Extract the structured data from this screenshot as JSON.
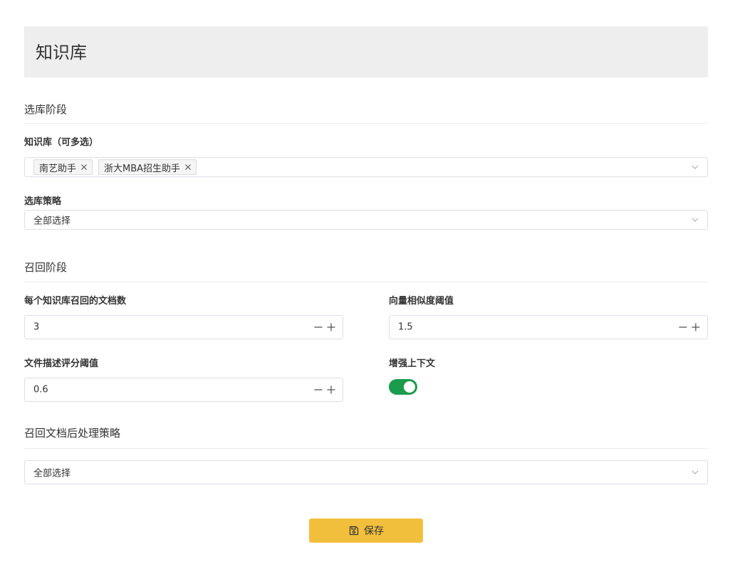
{
  "header": {
    "title": "知识库"
  },
  "selection_stage": {
    "title": "选库阶段",
    "kb_label": "知识库（可多选）",
    "kb_tags": [
      {
        "label": "南艺助手",
        "remove_icon": "close-icon"
      },
      {
        "label": "浙大MBA招生助手",
        "remove_icon": "close-icon"
      }
    ],
    "strategy_label": "选库策略",
    "strategy_value": "全部选择"
  },
  "recall_stage": {
    "title": "召回阶段",
    "docs_per_kb_label": "每个知识库召回的文档数",
    "docs_per_kb_value": "3",
    "vector_threshold_label": "向量相似度阈值",
    "vector_threshold_value": "1.5",
    "desc_threshold_label": "文件描述评分阈值",
    "desc_threshold_value": "0.6",
    "enhance_context_label": "增强上下文",
    "enhance_context_on": true
  },
  "post_process": {
    "title": "召回文档后处理策略",
    "strategy_value": "全部选择"
  },
  "actions": {
    "save_label": "保存",
    "save_icon": "floppy-disk-icon"
  },
  "colors": {
    "accent_yellow": "#f2bf3d",
    "toggle_green": "#1a9c4c",
    "header_bg": "#eeeeee",
    "border": "#dcdfe6"
  }
}
